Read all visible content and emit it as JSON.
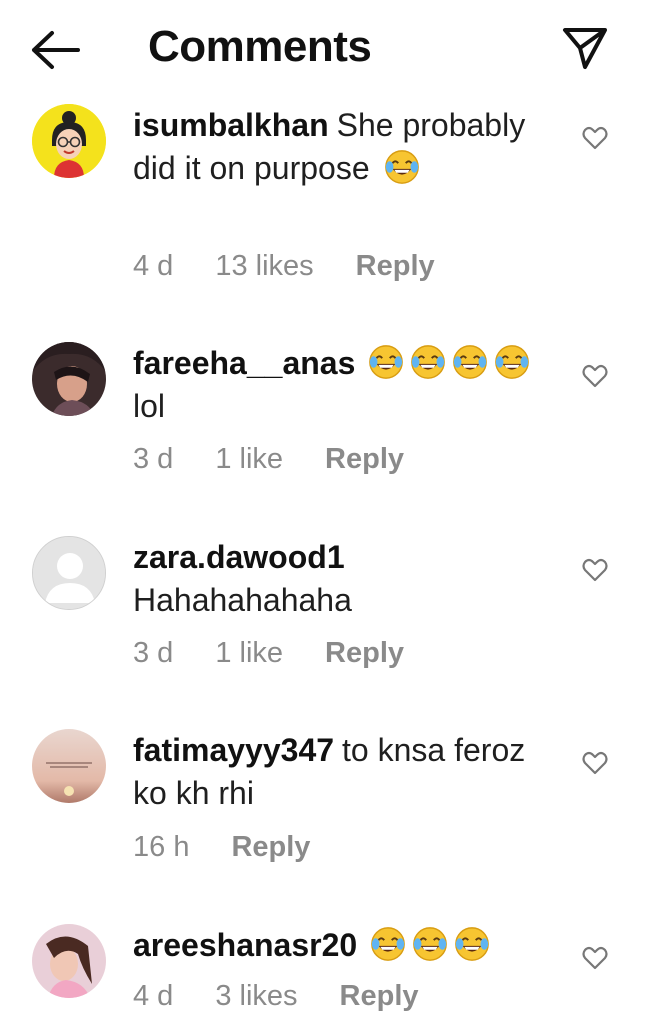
{
  "header": {
    "title": "Comments",
    "back_icon": "arrow-left-icon",
    "send_icon": "paper-plane-icon"
  },
  "comments": [
    {
      "username": "isumbalkhan",
      "text": "She probably did it on purpose",
      "emoji_count": 1,
      "time": "4 d",
      "likes": "13 likes",
      "reply": "Reply"
    },
    {
      "username": "fareeha__anas",
      "text": "lol",
      "emoji_count": 4,
      "time": "3 d",
      "likes": "1 like",
      "reply": "Reply"
    },
    {
      "username": "zara.dawood1",
      "text": "Hahahahahaha",
      "emoji_count": 0,
      "time": "3 d",
      "likes": "1 like",
      "reply": "Reply"
    },
    {
      "username": "fatimayyy347",
      "text": "to knsa feroz ko kh rhi",
      "emoji_count": 0,
      "time": "16 h",
      "likes": "",
      "reply": "Reply"
    },
    {
      "username": "areeshanasr20",
      "text": "",
      "emoji_count": 3,
      "time": "4 d",
      "likes": "3 likes",
      "reply": "Reply"
    }
  ],
  "colors": {
    "text": "#111111",
    "meta": "#8a8a8a",
    "emoji_face": "#f7c531"
  }
}
